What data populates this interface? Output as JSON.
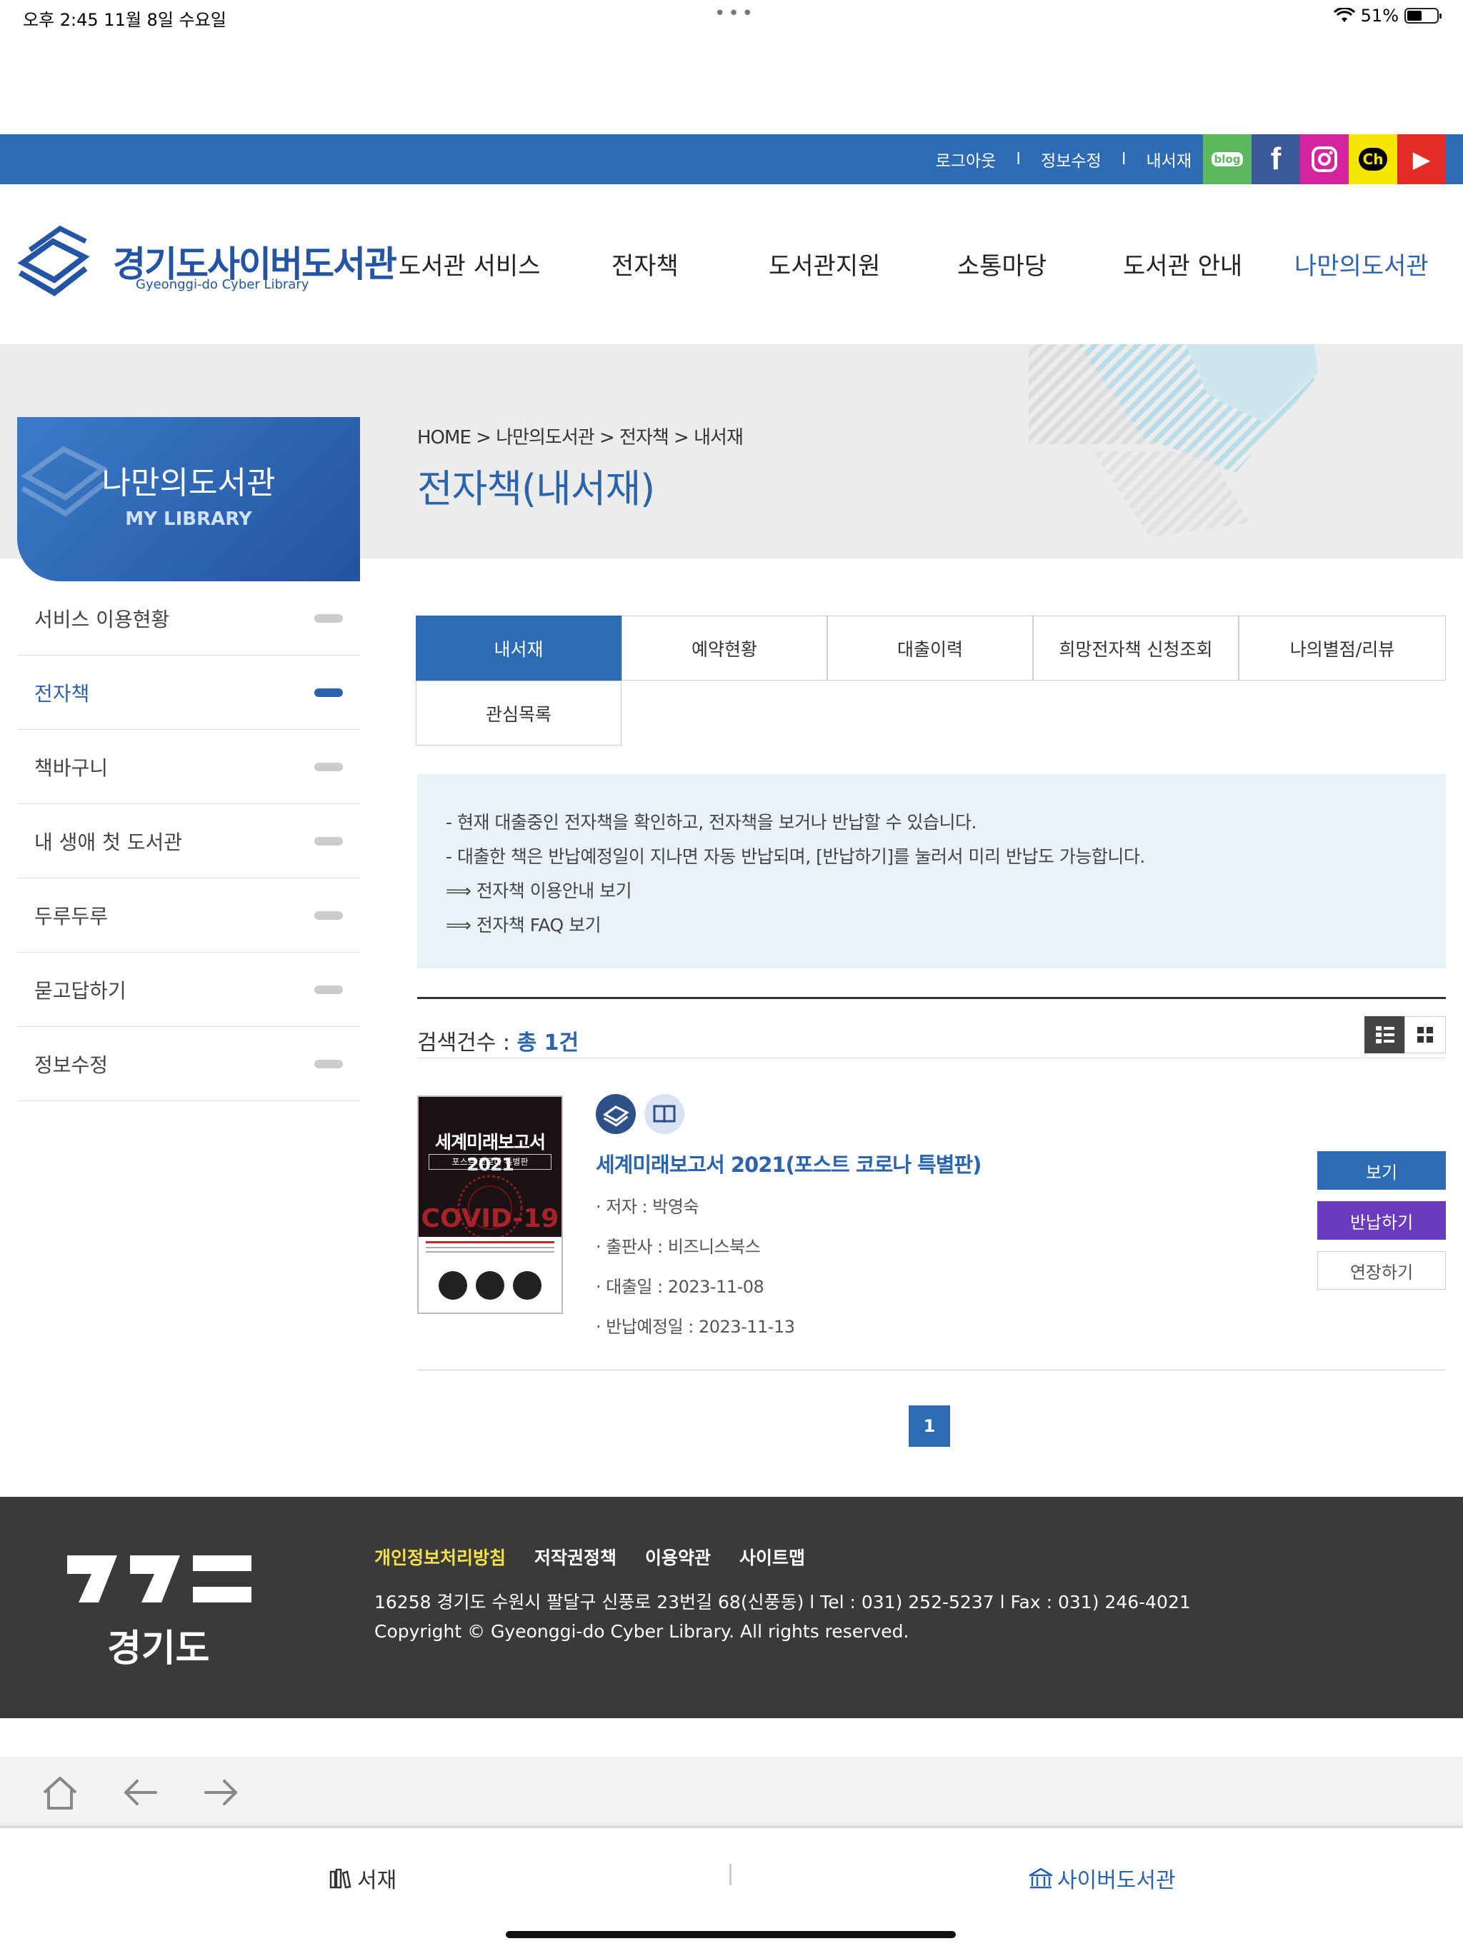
{
  "status_bar": {
    "time": "오후 2:45   11월 8일 수요일",
    "battery": "51%"
  },
  "topbar": {
    "links": [
      "로그아웃",
      "정보수정",
      "내서재"
    ],
    "social": [
      "blog",
      "f",
      "ig",
      "Ch",
      "▶"
    ]
  },
  "logo": {
    "title": "경기도사이버도서관",
    "subtitle": "Gyeonggi-do Cyber Library"
  },
  "nav": [
    "도서관 서비스",
    "전자책",
    "도서관지원",
    "소통마당",
    "도서관 안내",
    "나만의도서관"
  ],
  "breadcrumb": "HOME > 나만의도서관 > 전자책 > 내서재",
  "page_heading": "전자책(내서재)",
  "sidebar": {
    "title": "나만의도서관",
    "subtitle": "MY LIBRARY",
    "items": [
      "서비스 이용현황",
      "전자책",
      "책바구니",
      "내 생애 첫 도서관",
      "두루두루",
      "묻고답하기",
      "정보수정"
    ]
  },
  "tabs": [
    "내서재",
    "예약현황",
    "대출이력",
    "희망전자책 신청조회",
    "나의별점/리뷰",
    "관심목록"
  ],
  "info": [
    "-  현재 대출중인 전자책을 확인하고, 전자책을 보거나 반납할 수 있습니다.",
    "-  대출한 책은 반납예정일이 지나면 자동 반납되며, [반납하기]를 눌러서 미리 반납도 가능합니다.",
    "⟹ 전자책 이용안내 보기",
    "⟹ 전자책 FAQ 보기"
  ],
  "result": {
    "label": "검색건수 : ",
    "count": "총 1건"
  },
  "book": {
    "cover_title": "세계미래보고서 2021",
    "cover_sub": "포스트 코로나 특별판",
    "cover_covid": "COVID-19",
    "title": "세계미래보고서 2021(포스트 코로나 특별판)",
    "author": "· 저자 : 박영숙",
    "publisher": "· 출판사 : 비즈니스북스",
    "loan_date": "· 대출일 : 2023-11-08",
    "due_date": "· 반납예정일 : 2023-11-13"
  },
  "buttons": {
    "view": "보기",
    "return": "반납하기",
    "extend": "연장하기"
  },
  "pagination": {
    "current": "1"
  },
  "footer": {
    "logo_text": "경기도",
    "links": [
      "개인정보처리방침",
      "저작권정책",
      "이용약관",
      "사이트맵"
    ],
    "address": "16258 경기도 수원시 팔달구 신풍로 23번길 68(신풍동) l Tel : 031) 252-5237 l Fax : 031) 246-4021",
    "copyright": "Copyright © Gyeonggi-do Cyber Library. All rights reserved."
  },
  "bottom_tabs": {
    "shelf": "서재",
    "cyber": "사이버도서관"
  },
  "colors": {
    "primary": "#2d6cb5",
    "purple": "#6b3bbd",
    "footer": "#3a3a3a",
    "info_bg": "#e9f3f7"
  }
}
